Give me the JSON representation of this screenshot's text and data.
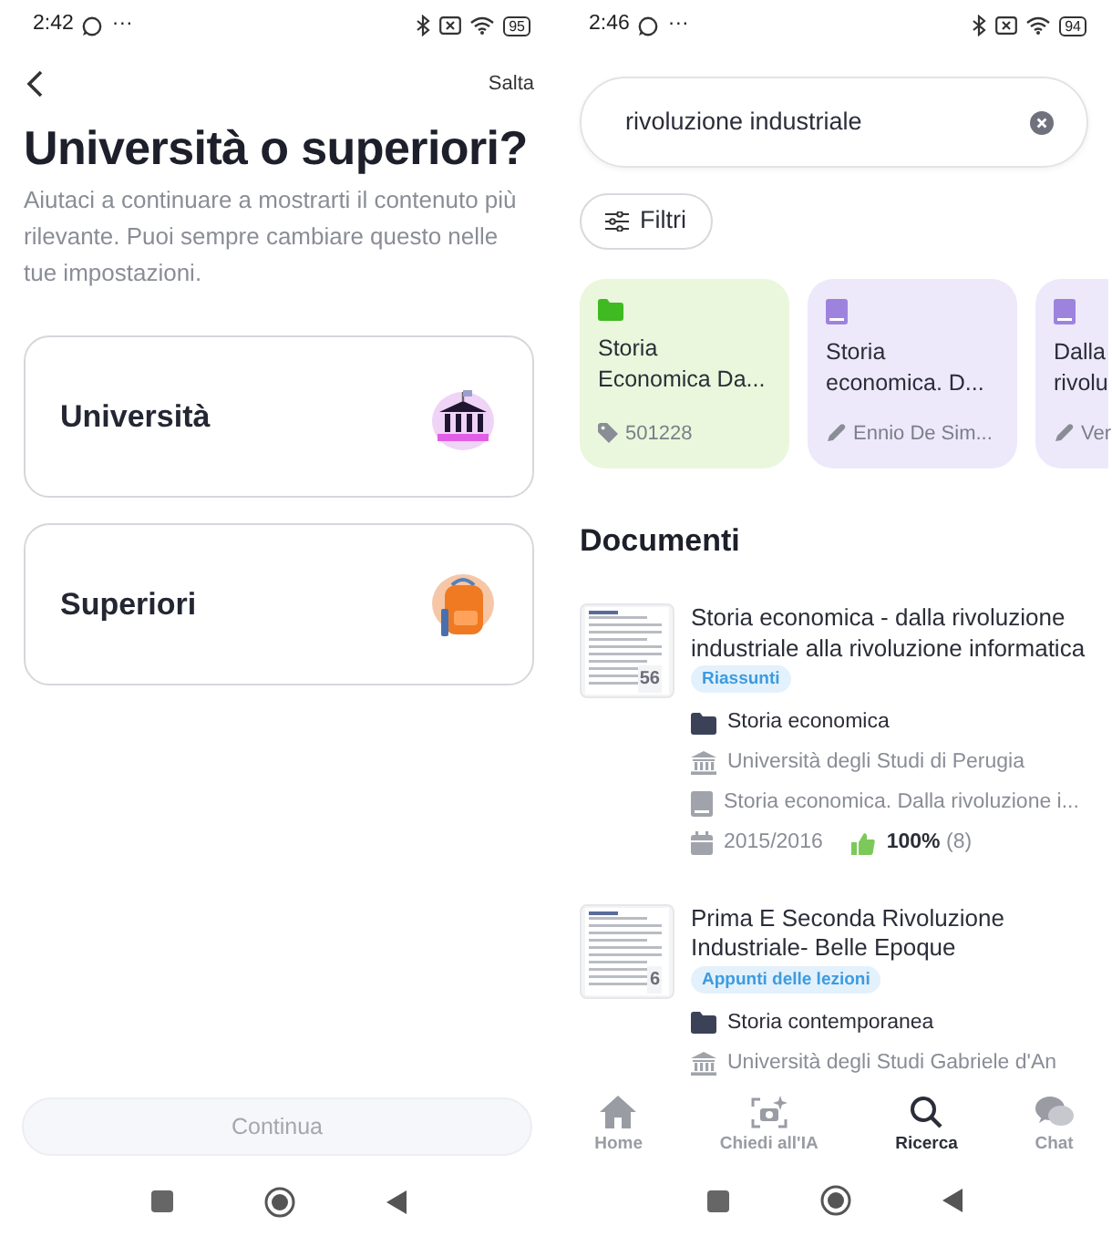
{
  "left": {
    "status_bar": {
      "time": "2:42",
      "more": "···",
      "battery": "95"
    },
    "skip_link": "Salta",
    "title": "Università o superiori?",
    "description": "Aiutaci a continuare a mostrarti il contenuto più rilevante. Puoi sempre cambiare questo nelle tue impostazioni.",
    "options": [
      {
        "label": "Università",
        "kind": "university"
      },
      {
        "label": "Superiori",
        "kind": "school"
      }
    ],
    "continue_button": {
      "label": "Continua",
      "disabled": true
    }
  },
  "right": {
    "status_bar": {
      "time": "2:46",
      "more": "···",
      "battery": "94"
    },
    "search": {
      "value": "rivoluzione industriale"
    },
    "filter_button": "Filtri",
    "results": [
      {
        "kind": "folder",
        "title_lines": [
          "Storia",
          "Economica Da..."
        ],
        "meta": {
          "kind": "tag",
          "text": "501228"
        }
      },
      {
        "kind": "book",
        "title_lines": [
          "Storia",
          "economica. D..."
        ],
        "meta": {
          "kind": "author",
          "text": "Ennio De Sim..."
        }
      },
      {
        "kind": "book",
        "title_lines": [
          "Dalla",
          "rivolu"
        ],
        "meta": {
          "kind": "author",
          "text": "Ver"
        }
      }
    ],
    "section_title": "Documenti",
    "documents": [
      {
        "title": "Storia economica - dalla rivoluzione industriale alla rivoluzione informatica",
        "pages": "56",
        "tag": "Riassunti",
        "meta": [
          {
            "kind": "folder",
            "text": "Storia economica"
          },
          {
            "kind": "university",
            "text": "Università degli Studi di Perugia"
          },
          {
            "kind": "book",
            "text": "Storia economica. Dalla rivoluzione i..."
          },
          {
            "kind": "date",
            "text": "2015/2016",
            "rating": "**100%** (8)"
          }
        ]
      },
      {
        "title": "Prima E Seconda Rivoluzione Industriale- Belle Epoque",
        "pages": "6",
        "tag": "Appunti delle lezioni",
        "meta": [
          {
            "kind": "folder",
            "text": "Storia contemporanea"
          },
          {
            "kind": "university",
            "text": "Università degli Studi Gabriele d'An"
          }
        ]
      }
    ],
    "bottom_nav": [
      {
        "label": "Home",
        "kind": "home",
        "selected": false
      },
      {
        "label": "Chiedi all'IA",
        "kind": "camera",
        "selected": false
      },
      {
        "label": "Ricerca",
        "kind": "search",
        "selected": true
      },
      {
        "label": "Chat",
        "kind": "chat",
        "selected": false
      }
    ]
  }
}
